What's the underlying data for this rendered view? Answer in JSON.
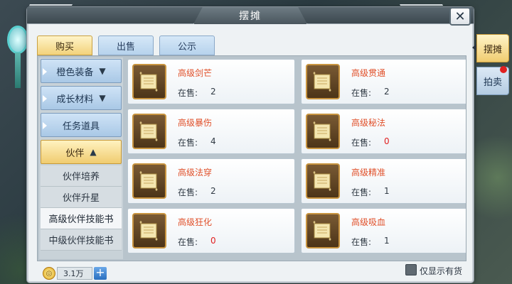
{
  "window": {
    "title": "摆摊",
    "close_label": "✕"
  },
  "tabs": [
    {
      "label": "购买",
      "active": true
    },
    {
      "label": "出售",
      "active": false
    },
    {
      "label": "公示",
      "active": false
    }
  ],
  "sidebar": {
    "categories": [
      {
        "label": "橙色装备",
        "arrow": "▼"
      },
      {
        "label": "成长材料",
        "arrow": "▼"
      },
      {
        "label": "任务道具",
        "arrow": ""
      },
      {
        "label": "伙伴",
        "arrow": "▲"
      }
    ],
    "subitems": [
      {
        "label": "伙伴培养"
      },
      {
        "label": "伙伴升星"
      },
      {
        "label": "高级伙伴技能书"
      },
      {
        "label": "中级伙伴技能书"
      }
    ]
  },
  "items": [
    {
      "name": "高级剑芒",
      "stock_label": "在售:",
      "stock": "2"
    },
    {
      "name": "高级贯通",
      "stock_label": "在售:",
      "stock": "2"
    },
    {
      "name": "高级暴伤",
      "stock_label": "在售:",
      "stock": "4"
    },
    {
      "name": "高级秘法",
      "stock_label": "在售:",
      "stock": "0"
    },
    {
      "name": "高级法穿",
      "stock_label": "在售:",
      "stock": "2"
    },
    {
      "name": "高级精准",
      "stock_label": "在售:",
      "stock": "1"
    },
    {
      "name": "高级狂化",
      "stock_label": "在售:",
      "stock": "0"
    },
    {
      "name": "高级吸血",
      "stock_label": "在售:",
      "stock": "1"
    }
  ],
  "footer": {
    "money": "3.1万",
    "add_label": "+",
    "filter_label": "仅显示有货",
    "filter_checked": false
  },
  "side_tabs": [
    {
      "label": "摆摊",
      "active": true
    },
    {
      "label": "拍卖",
      "active": false,
      "notification": true
    }
  ],
  "icons": {
    "item_icon": "scroll-icon",
    "coin_icon": "coin-icon",
    "close_icon": "close-icon"
  }
}
